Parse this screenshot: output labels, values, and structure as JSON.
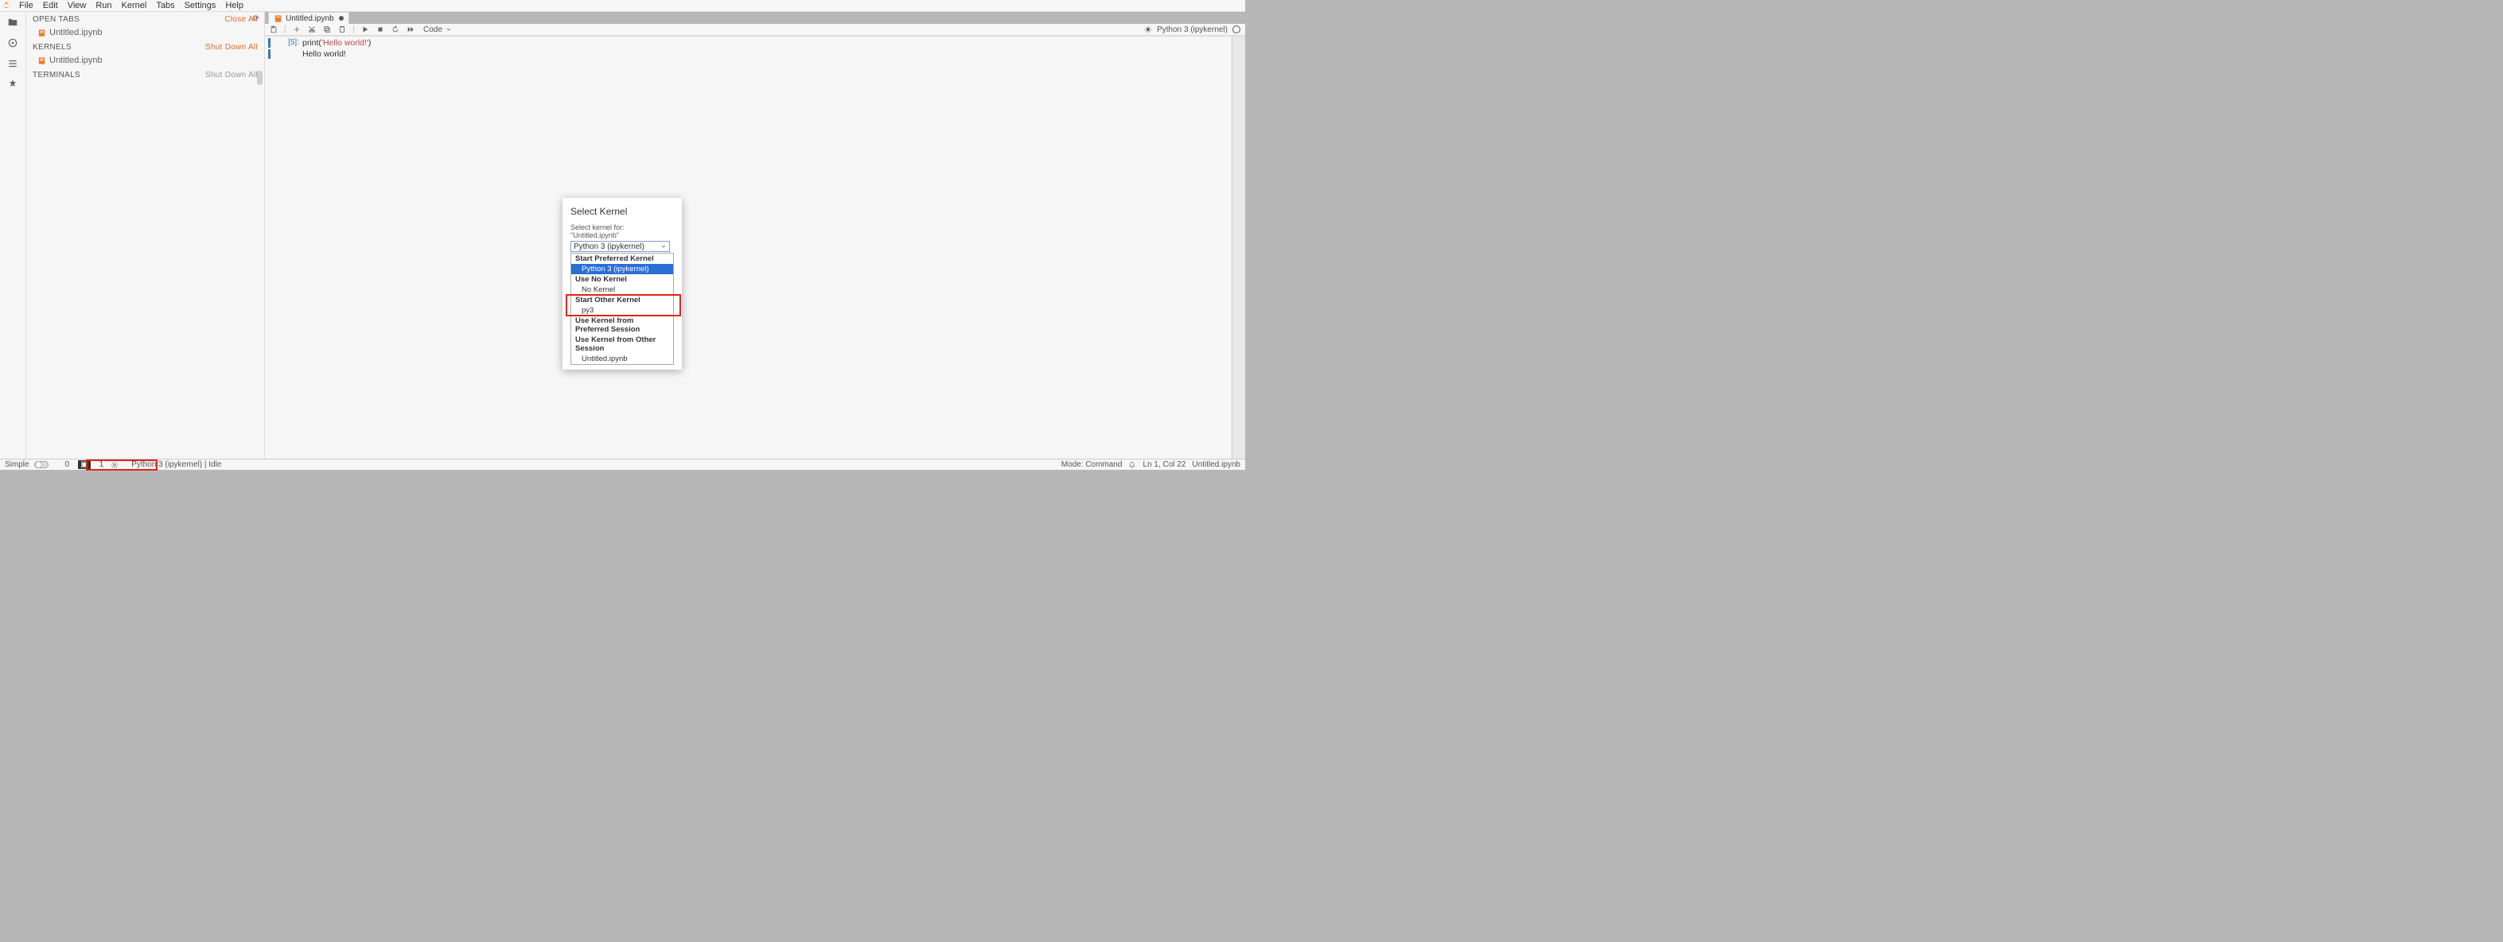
{
  "menu": {
    "items": [
      "File",
      "Edit",
      "View",
      "Run",
      "Kernel",
      "Tabs",
      "Settings",
      "Help"
    ]
  },
  "sidebar": {
    "open_tabs": {
      "title": "OPEN TABS",
      "action": "Close All",
      "items": [
        {
          "label": "Untitled.ipynb"
        }
      ]
    },
    "kernels": {
      "title": "KERNELS",
      "action": "Shut Down All",
      "items": [
        {
          "label": "Untitled.ipynb"
        }
      ]
    },
    "terminals": {
      "title": "TERMINALS",
      "action": "Shut Down All"
    }
  },
  "tab": {
    "label": "Untitled.ipynb",
    "dirty": true
  },
  "toolbar": {
    "cell_type": "Code",
    "kernel": "Python 3 (ipykernel)"
  },
  "cell": {
    "prompt": "[5]:",
    "code_prefix": "print(",
    "code_str": "'Hello world!'",
    "code_suffix": ")",
    "output": "Hello world!"
  },
  "dialog": {
    "title": "Select Kernel",
    "subtitle": "Select kernel for: \"Untitled.ipynb\"",
    "selected": "Python 3 (ipykernel)",
    "groups": [
      {
        "label": "Start Preferred Kernel",
        "items": [
          {
            "label": "Python 3 (ipykernel)",
            "selected": true
          }
        ]
      },
      {
        "label": "Use No Kernel",
        "items": [
          {
            "label": "No Kernel"
          }
        ]
      },
      {
        "label": "Start Other Kernel",
        "items": [
          {
            "label": "py3"
          }
        ],
        "highlight": true
      },
      {
        "label": "Use Kernel from Preferred Session",
        "items": []
      },
      {
        "label": "Use Kernel from Other Session",
        "items": [
          {
            "label": "Untitled.ipynb"
          }
        ]
      }
    ]
  },
  "status": {
    "simple": "Simple",
    "zero": "0",
    "panes_icon": "▣",
    "one": "1",
    "kernel": "Python 3 (ipykernel) | Idle",
    "mode": "Mode: Command",
    "cursor": "Ln 1, Col 22",
    "file": "Untitled.ipynb"
  }
}
